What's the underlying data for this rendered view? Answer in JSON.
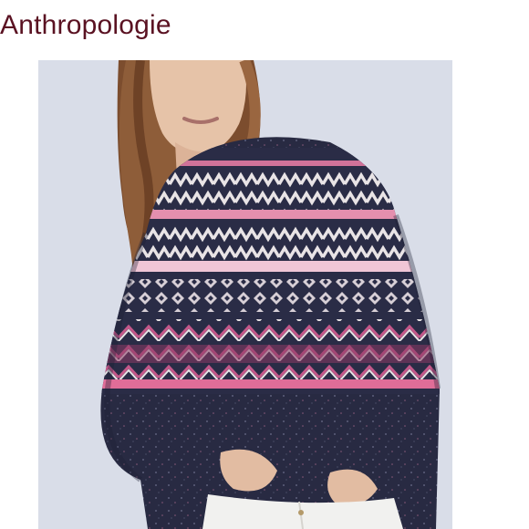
{
  "header": {
    "brand": "Anthropologie"
  },
  "photo": {
    "subject": "",
    "colors": {
      "background": "#d9dde8",
      "knit_base": "#2a2c46",
      "pink": "#e27aa2",
      "plum": "#8b3a64",
      "cream": "#e9e4e6",
      "hair": "#8b5a36",
      "skin": "#e6c3a8",
      "jeans": "#f1f1ef",
      "brand_text": "#5a1222"
    }
  }
}
